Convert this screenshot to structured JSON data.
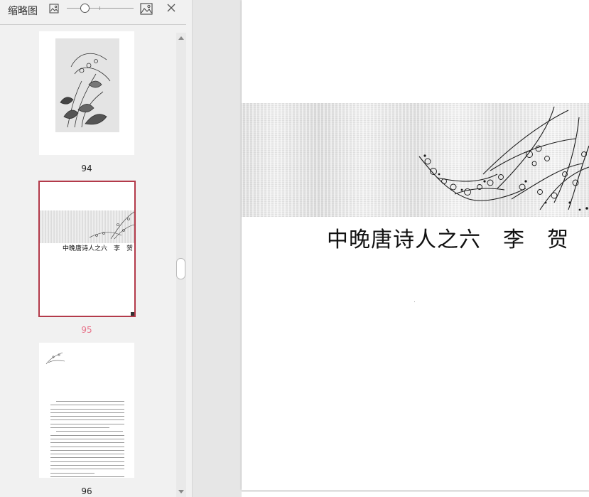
{
  "sidebar": {
    "title": "缩略图",
    "close_symbol": "✕",
    "zoom": {
      "small_icon": "image-small-icon",
      "large_icon": "image-large-icon",
      "level": 0.25
    }
  },
  "thumbnails": [
    {
      "page": "94",
      "selected": false
    },
    {
      "page": "95",
      "selected": true,
      "title": "中晚唐诗人之六　李　贺"
    },
    {
      "page": "96",
      "selected": false
    }
  ],
  "main": {
    "title": "中晚唐诗人之六　李　贺"
  },
  "colors": {
    "selected_border": "#b33a4a",
    "selected_number": "#e8738a"
  }
}
